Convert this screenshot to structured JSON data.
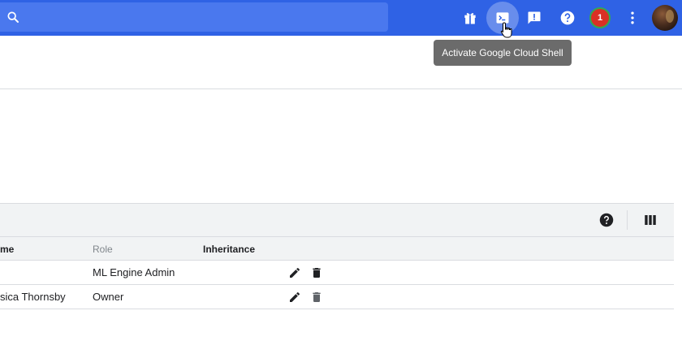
{
  "topbar": {
    "search_placeholder": "",
    "icons": [
      "search-icon",
      "gift-icon",
      "cloud-shell-icon",
      "feedback-icon",
      "help-icon",
      "more-vert-icon"
    ],
    "notification_count": "1",
    "accent": "#2f62e5"
  },
  "tooltip": {
    "text": "Activate Google Cloud Shell"
  },
  "table": {
    "columns": [
      "me",
      "Role",
      "Inheritance"
    ],
    "rows": [
      {
        "member": "",
        "role": "ML Engine Admin",
        "inheritance": ""
      },
      {
        "member": "sica Thornsby",
        "role": "Owner",
        "inheritance": ""
      }
    ]
  }
}
